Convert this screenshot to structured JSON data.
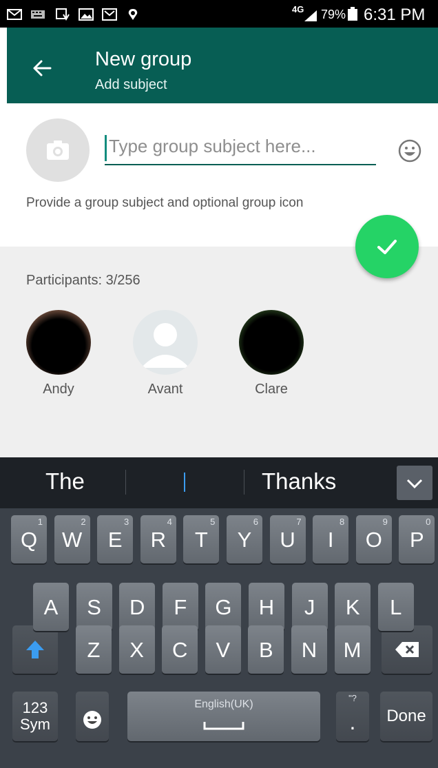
{
  "status_bar": {
    "network": "4G",
    "battery": "79%",
    "time": "6:31 PM",
    "icons": [
      "mail-icon",
      "keyboard-icon",
      "download-icon",
      "image-icon",
      "gmail-icon",
      "location-icon"
    ]
  },
  "header": {
    "title": "New group",
    "subtitle": "Add subject"
  },
  "subject": {
    "placeholder": "Type group subject here...",
    "hint": "Provide a group subject and optional group icon"
  },
  "participants": {
    "label": "Participants: 3/256",
    "list": [
      {
        "name": "Andy"
      },
      {
        "name": "Avant"
      },
      {
        "name": "Clare"
      }
    ]
  },
  "keyboard": {
    "suggestions": [
      "The",
      "I",
      "Thanks"
    ],
    "row1": [
      {
        "key": "Q",
        "num": "1"
      },
      {
        "key": "W",
        "num": "2"
      },
      {
        "key": "E",
        "num": "3"
      },
      {
        "key": "R",
        "num": "4"
      },
      {
        "key": "T",
        "num": "5"
      },
      {
        "key": "Y",
        "num": "6"
      },
      {
        "key": "U",
        "num": "7"
      },
      {
        "key": "I",
        "num": "8"
      },
      {
        "key": "O",
        "num": "9"
      },
      {
        "key": "P",
        "num": "0"
      }
    ],
    "row2": [
      "A",
      "S",
      "D",
      "F",
      "G",
      "H",
      "J",
      "K",
      "L"
    ],
    "row3": [
      "Z",
      "X",
      "C",
      "V",
      "B",
      "N",
      "M"
    ],
    "sym_label_1": "123",
    "sym_label_2": "Sym",
    "space_label": "English(UK)",
    "period": ".",
    "period_hint": "\"?",
    "done_label": "Done"
  },
  "colors": {
    "appbar": "#075e54",
    "accent": "#128c7e",
    "fab": "#25d366"
  }
}
